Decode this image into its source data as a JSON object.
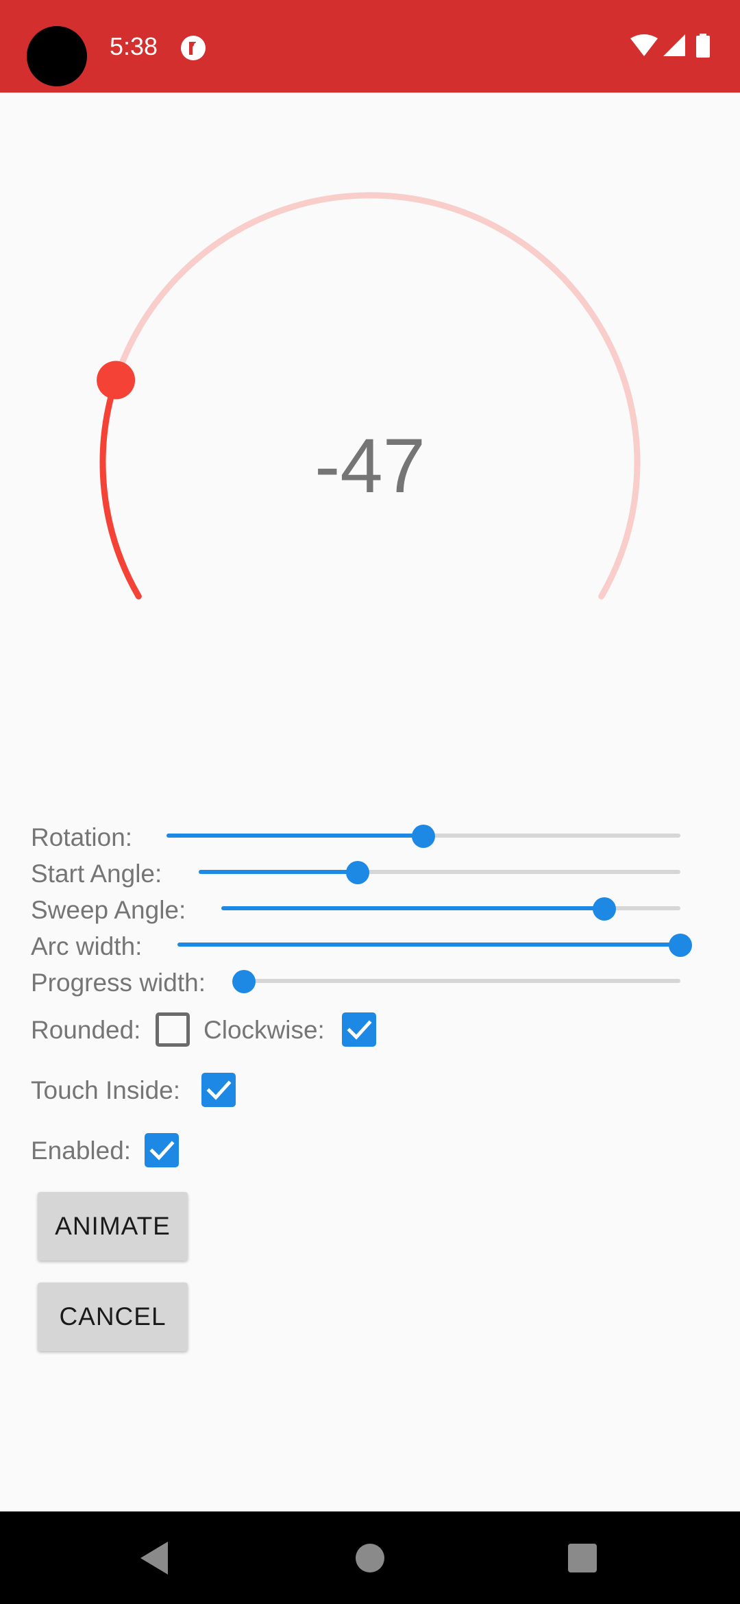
{
  "status_bar": {
    "time": "5:38",
    "background": "#d32f2f",
    "icons": [
      "notification-icon",
      "wifi-icon",
      "signal-icon",
      "battery-icon"
    ]
  },
  "arc": {
    "value": "-47",
    "progress_color": "#f44336",
    "track_color": "#f8cdca"
  },
  "controls": {
    "rotation": {
      "label": "Rotation:",
      "level": 0.5
    },
    "start_angle": {
      "label": "Start Angle:",
      "level": 0.33
    },
    "sweep_angle": {
      "label": "Sweep Angle:",
      "level": 0.835
    },
    "arc_width": {
      "label": "Arc width:",
      "level": 1.0
    },
    "progress_width": {
      "label": "Progress width:",
      "level": 0.0
    },
    "rounded": {
      "label": "Rounded:",
      "checked": false
    },
    "clockwise": {
      "label": "Clockwise:",
      "checked": true
    },
    "touch_inside": {
      "label": "Touch Inside:",
      "checked": true
    },
    "enabled": {
      "label": "Enabled:",
      "checked": true
    }
  },
  "buttons": {
    "animate": "ANIMATE",
    "cancel": "CANCEL"
  },
  "accent_color": "#1e88e5",
  "nav_bar": {
    "icons": [
      "back-icon",
      "home-icon",
      "recents-icon"
    ]
  }
}
